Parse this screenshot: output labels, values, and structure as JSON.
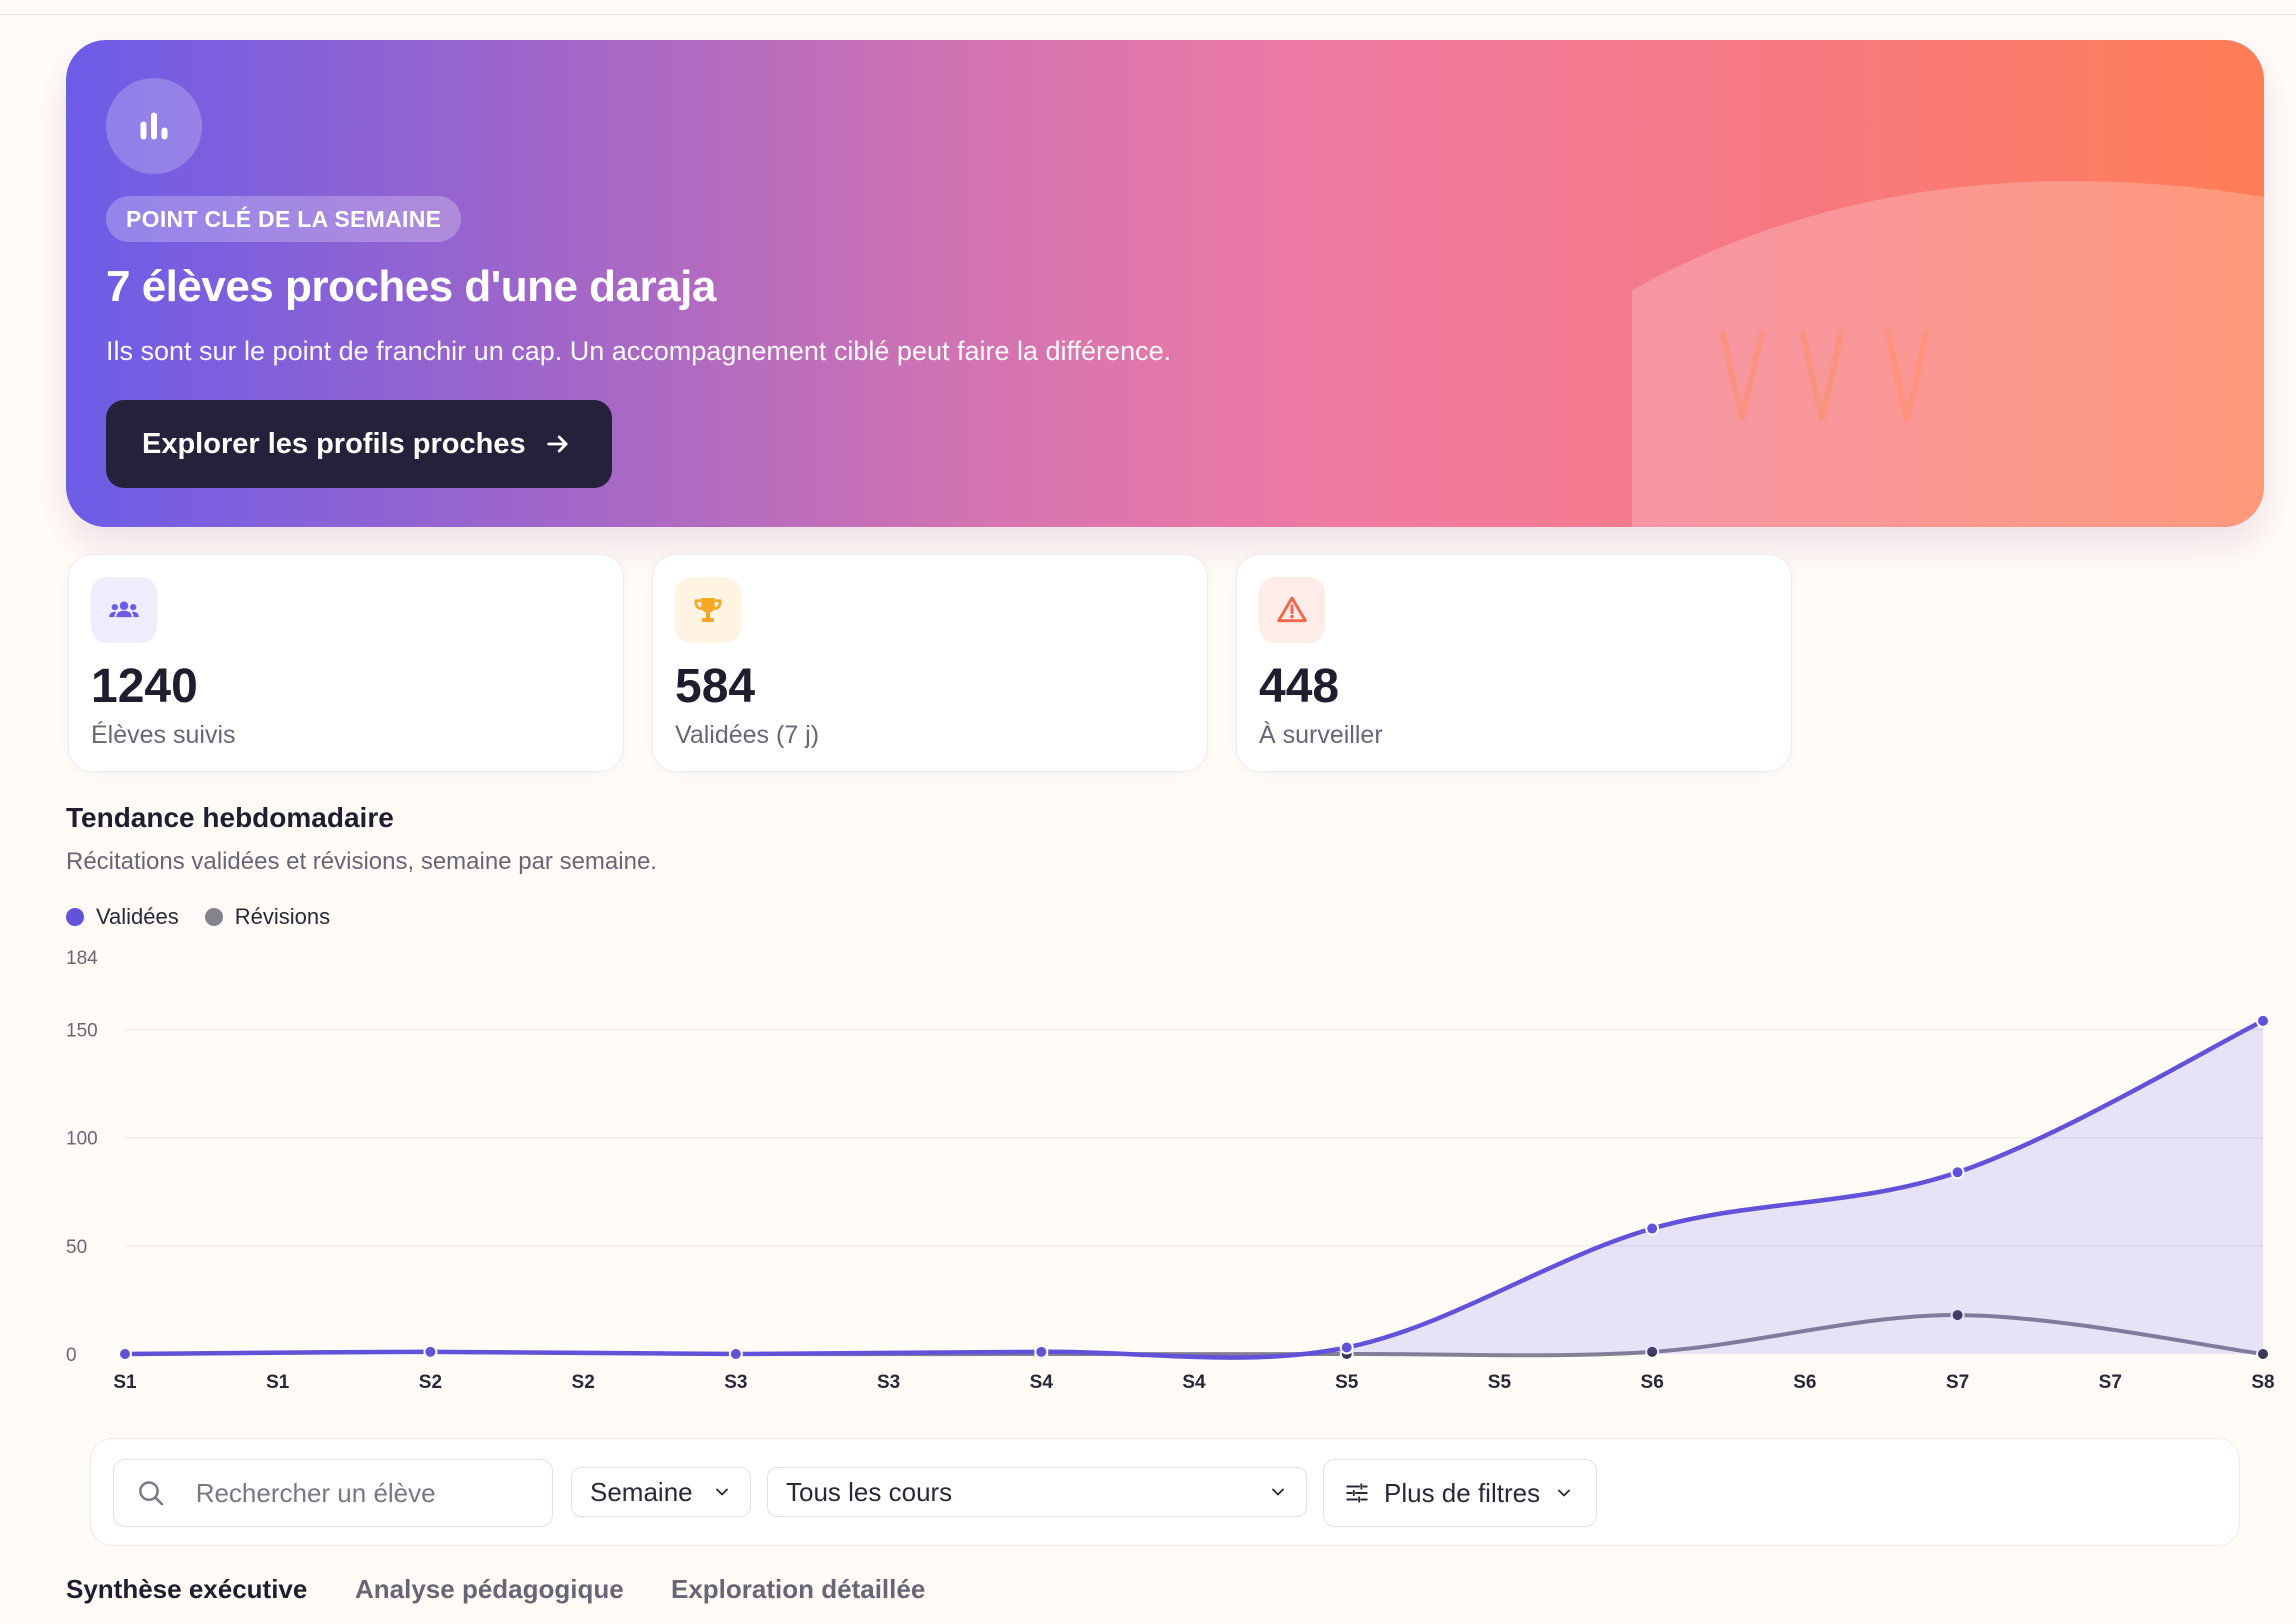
{
  "hero": {
    "icon": "bar-chart-icon",
    "badge": "POINT CLÉ DE LA SEMAINE",
    "title": "7 élèves proches d'une daraja",
    "subtitle": "Ils sont sur le point de franchir un cap. Un accompagnement ciblé peut faire la différence.",
    "cta_label": "Explorer les profils proches"
  },
  "stats": [
    {
      "icon": "users-icon",
      "value": "1240",
      "label": "Élèves suivis",
      "color": "#6c5ce7",
      "bg": "#efedfc"
    },
    {
      "icon": "trophy-icon",
      "value": "584",
      "label": "Validées (7 j)",
      "color": "#f5a623",
      "bg": "#fff4e2"
    },
    {
      "icon": "warning-icon",
      "value": "448",
      "label": "À surveiller",
      "color": "#f0674e",
      "bg": "#fdece8"
    }
  ],
  "chart_section": {
    "title": "Tendance hebdomadaire",
    "subtitle": "Récitations validées et révisions, semaine par semaine."
  },
  "chart_data": {
    "type": "area",
    "x": [
      "S1",
      "S1",
      "S2",
      "S2",
      "S3",
      "S3",
      "S4",
      "S4",
      "S5",
      "S5",
      "S6",
      "S6",
      "S7",
      "S7",
      "S8"
    ],
    "points_x": [
      0,
      2,
      4,
      6,
      8,
      10,
      12,
      14
    ],
    "series": [
      {
        "name": "Validées",
        "color": "#6152d9",
        "values": [
          0,
          1,
          0,
          1,
          3,
          58,
          84,
          154
        ]
      },
      {
        "name": "Révisions",
        "color": "#85818f",
        "values": [
          0,
          1,
          0,
          0,
          0,
          1,
          18,
          0
        ]
      }
    ],
    "yticks": [
      0,
      50,
      100,
      150
    ],
    "ymax_label": "184",
    "ylim": [
      0,
      184
    ],
    "grid": true,
    "legend": "top-left"
  },
  "filters": {
    "search_placeholder": "Rechercher un élève",
    "period": "Semaine",
    "course": "Tous les cours",
    "more": "Plus de filtres"
  },
  "tabs": [
    {
      "label": "Synthèse exécutive",
      "active": true
    },
    {
      "label": "Analyse pédagogique",
      "active": false
    },
    {
      "label": "Exploration détaillée",
      "active": false
    }
  ]
}
